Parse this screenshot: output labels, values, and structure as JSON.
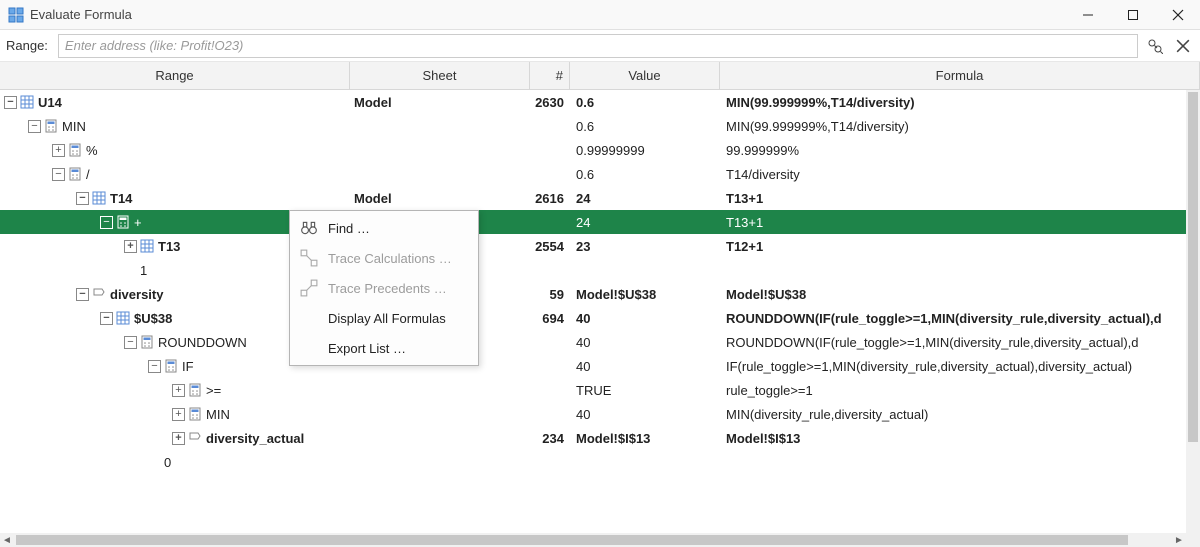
{
  "window": {
    "title": "Evaluate Formula"
  },
  "rangebar": {
    "label": "Range:",
    "placeholder": "Enter address (like: Profit!O23)"
  },
  "columns": {
    "range": "Range",
    "sheet": "Sheet",
    "num": "#",
    "value": "Value",
    "formula": "Formula"
  },
  "contextMenu": {
    "find": "Find …",
    "traceCalc": "Trace Calculations …",
    "tracePrec": "Trace Precedents …",
    "displayAll": "Display All Formulas",
    "exportList": "Export List …"
  },
  "rows": [
    {
      "depth": 0,
      "toggle": "-",
      "icon": "grid",
      "name": "U14",
      "sheet": "Model",
      "num": "2630",
      "value": "0.6",
      "formula": "MIN(99.999999%,T14/diversity)",
      "bold": true
    },
    {
      "depth": 1,
      "toggle": "-",
      "icon": "calc",
      "name": "MIN",
      "sheet": "",
      "num": "",
      "value": "0.6",
      "formula": "MIN(99.999999%,T14/diversity)",
      "bold": false
    },
    {
      "depth": 2,
      "toggle": "+",
      "icon": "calc",
      "name": "%",
      "sheet": "",
      "num": "",
      "value": "0.99999999",
      "formula": "99.999999%",
      "bold": false
    },
    {
      "depth": 2,
      "toggle": "-",
      "icon": "calc",
      "name": "/",
      "sheet": "",
      "num": "",
      "value": "0.6",
      "formula": "T14/diversity",
      "bold": false
    },
    {
      "depth": 3,
      "toggle": "-",
      "icon": "grid",
      "name": "T14",
      "sheet": "Model",
      "num": "2616",
      "value": "24",
      "formula": "T13+1",
      "bold": true
    },
    {
      "depth": 4,
      "toggle": "-",
      "icon": "calc",
      "name": "+",
      "sheet": "",
      "num": "",
      "value": "24",
      "formula": "T13+1",
      "bold": false,
      "selected": true
    },
    {
      "depth": 5,
      "toggle": "+",
      "icon": "grid",
      "name": "T13",
      "sheet": "",
      "num": "2554",
      "value": "23",
      "formula": "T12+1",
      "bold": true
    },
    {
      "depth": 5,
      "toggle": "",
      "icon": "",
      "name": "1",
      "sheet": "",
      "num": "",
      "value": "",
      "formula": "",
      "bold": false
    },
    {
      "depth": 3,
      "toggle": "-",
      "icon": "name",
      "name": "diversity",
      "sheet": "",
      "num": "59",
      "value": "Model!$U$38",
      "formula": "Model!$U$38",
      "bold": true
    },
    {
      "depth": 4,
      "toggle": "-",
      "icon": "grid",
      "name": "$U$38",
      "sheet": "",
      "num": "694",
      "value": "40",
      "formula": "ROUNDDOWN(IF(rule_toggle>=1,MIN(diversity_rule,diversity_actual),d",
      "bold": true
    },
    {
      "depth": 5,
      "toggle": "-",
      "icon": "calc",
      "name": "ROUNDDOWN",
      "sheet": "",
      "num": "",
      "value": "40",
      "formula": "ROUNDDOWN(IF(rule_toggle>=1,MIN(diversity_rule,diversity_actual),d",
      "bold": false
    },
    {
      "depth": 6,
      "toggle": "-",
      "icon": "calc",
      "name": "IF",
      "sheet": "",
      "num": "",
      "value": "40",
      "formula": "IF(rule_toggle>=1,MIN(diversity_rule,diversity_actual),diversity_actual)",
      "bold": false
    },
    {
      "depth": 7,
      "toggle": "+",
      "icon": "calc",
      "name": ">=",
      "sheet": "",
      "num": "",
      "value": "TRUE",
      "formula": "rule_toggle>=1",
      "bold": false
    },
    {
      "depth": 7,
      "toggle": "+",
      "icon": "calc",
      "name": "MIN",
      "sheet": "",
      "num": "",
      "value": "40",
      "formula": "MIN(diversity_rule,diversity_actual)",
      "bold": false
    },
    {
      "depth": 7,
      "toggle": "+",
      "icon": "name",
      "name": "diversity_actual",
      "sheet": "",
      "num": "234",
      "value": "Model!$I$13",
      "formula": "Model!$I$13",
      "bold": true
    },
    {
      "depth": 6,
      "toggle": "",
      "icon": "",
      "name": "0",
      "sheet": "",
      "num": "",
      "value": "",
      "formula": "",
      "bold": false
    }
  ]
}
